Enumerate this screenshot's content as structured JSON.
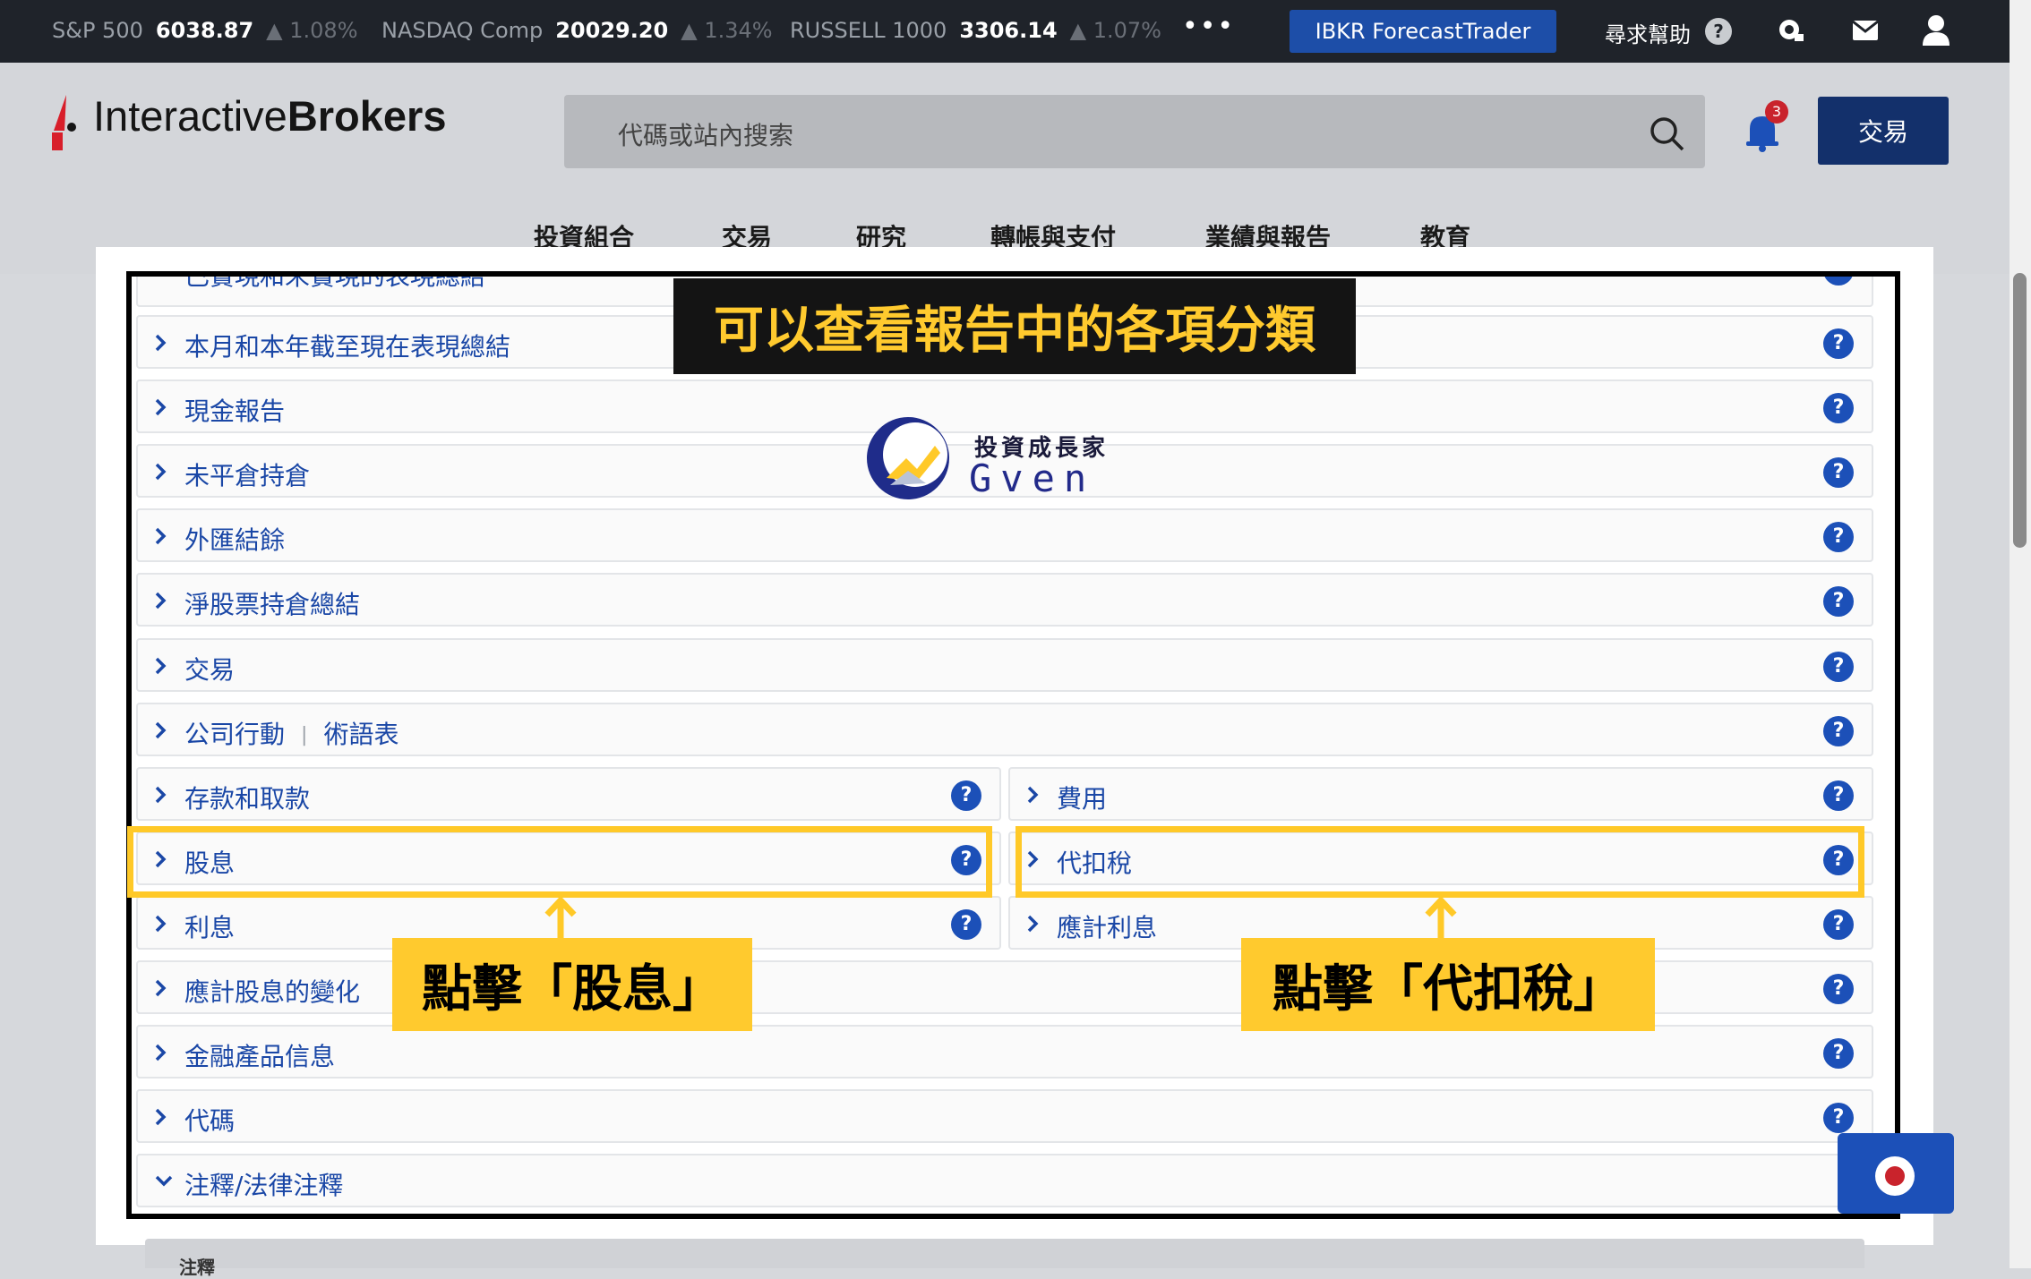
{
  "ticker": {
    "items": [
      {
        "name": "S&P 500",
        "value": "6038.87",
        "change": "▲ 1.08%"
      },
      {
        "name": "NASDAQ Comp",
        "value": "20029.20",
        "change": "▲ 1.34%"
      },
      {
        "name": "RUSSELL 1000",
        "value": "3306.14",
        "change": "▲ 1.07%"
      }
    ],
    "more": "•••",
    "forecast_button": "IBKR ForecastTrader",
    "help_label": "尋求幫助",
    "help_icon": "?"
  },
  "header": {
    "logo_part1": "Interactive",
    "logo_part2": "Brokers",
    "search_placeholder": "代碼或站內搜索",
    "notification_count": "3",
    "trade_button": "交易",
    "nav": [
      "投資組合",
      "交易",
      "研究",
      "轉帳與支付",
      "業績與報告",
      "教育"
    ]
  },
  "report_sections": {
    "partial_top": "已實現和未實現的表現總結",
    "full_rows": [
      "本月和本年截至現在表現總結",
      "現金報告",
      "未平倉持倉",
      "外匯結餘",
      "淨股票持倉總結",
      "交易"
    ],
    "corporate_actions": "公司行動",
    "glossary": "術語表",
    "left_col": [
      "存款和取款",
      "股息",
      "利息"
    ],
    "right_col": [
      "費用",
      "代扣稅",
      "應計利息"
    ],
    "bottom_rows": [
      "應計股息的變化",
      "金融產品信息",
      "代碼"
    ],
    "notes": "注釋/法律注釋",
    "help_icon": "?"
  },
  "annotations": {
    "title": "可以查看報告中的各項分類",
    "callout_dividend": "點擊「股息」",
    "callout_withholding": "點擊「代扣稅」",
    "watermark_cn": "投資成長家",
    "watermark_en": "Gven"
  },
  "footer": {
    "label": "注釋"
  },
  "colors": {
    "accent": "#1c50b8",
    "highlight": "#ffc928",
    "link": "#1a47a6"
  }
}
